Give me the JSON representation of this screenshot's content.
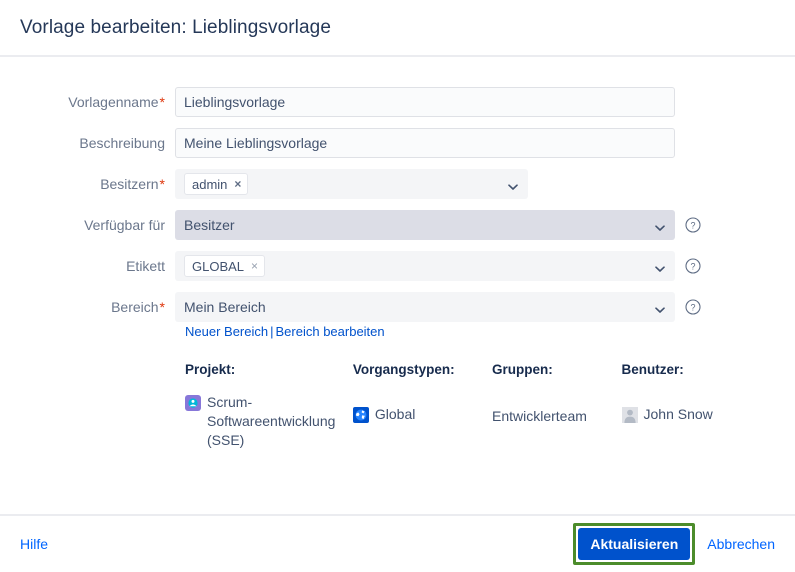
{
  "header": {
    "title": "Vorlage bearbeiten: Lieblingsvorlage"
  },
  "form": {
    "fields": [
      {
        "label": "Vorlagenname",
        "required": true,
        "value": "Lieblingsvorlage",
        "type": "text"
      },
      {
        "label": "Beschreibung",
        "required": false,
        "value": "Meine Lieblingsvorlage",
        "type": "text"
      },
      {
        "label": "Besitzern",
        "required": true,
        "chip": "admin",
        "chip_remove": "×",
        "type": "multiselect"
      },
      {
        "label": "Verfügbar für",
        "required": false,
        "value": "Besitzer",
        "type": "select",
        "has_help": true
      },
      {
        "label": "Etikett",
        "required": false,
        "chip": "GLOBAL",
        "chip_remove": "×",
        "type": "multiselect",
        "has_help": true
      },
      {
        "label": "Bereich",
        "required": true,
        "value": "Mein Bereich",
        "type": "select",
        "has_help": true
      }
    ],
    "sublinks": {
      "new_scope": "Neuer Bereich",
      "separator": "|",
      "edit_scope": "Bereich bearbeiten"
    }
  },
  "summary": {
    "columns": [
      {
        "heading": "Projekt:",
        "icon": "project-avatar-icon",
        "value": "Scrum-Softwareentwicklung (SSE)"
      },
      {
        "heading": "Vorgangstypen:",
        "icon": "globe-icon",
        "value": "Global"
      },
      {
        "heading": "Gruppen:",
        "icon": null,
        "value": "Entwicklerteam"
      },
      {
        "heading": "Benutzer:",
        "icon": "user-avatar-icon",
        "value": "John Snow"
      }
    ]
  },
  "footer": {
    "help_label": "Hilfe",
    "submit_label": "Aktualisieren",
    "cancel_label": "Abbrechen"
  },
  "colors": {
    "primary_button": "#0052cc",
    "link": "#0065ff",
    "highlight": "#4c8c2b",
    "required_asterisk": "#de350b",
    "label_text": "#6b778c",
    "title_text": "#253858"
  }
}
